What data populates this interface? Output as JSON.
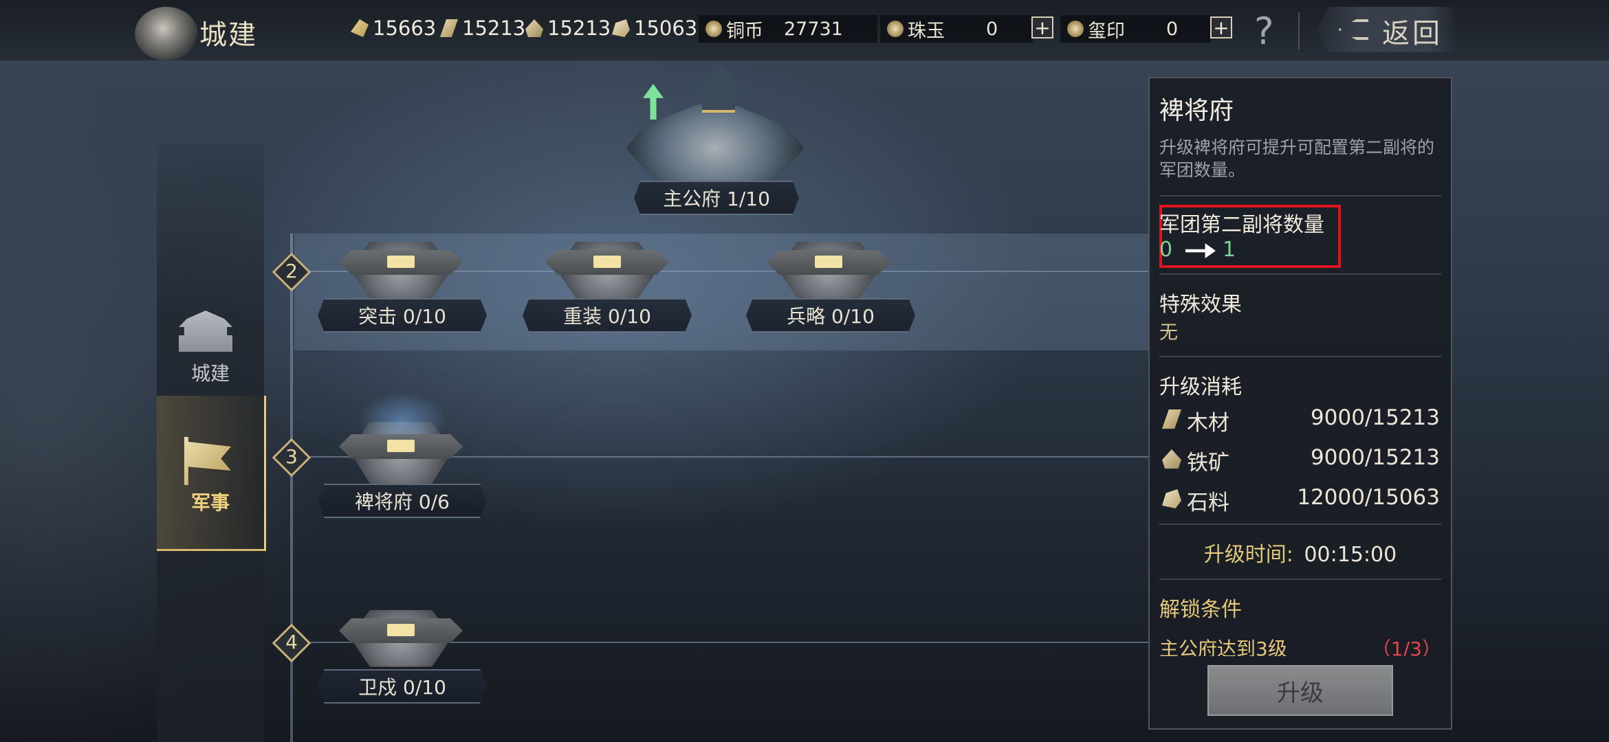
{
  "header": {
    "title": "城建",
    "resources": [
      {
        "icon": "grain-icon",
        "value": "15663"
      },
      {
        "icon": "wood-icon",
        "value": "15213"
      },
      {
        "icon": "iron-icon",
        "value": "15213"
      },
      {
        "icon": "stone-icon",
        "value": "15063"
      }
    ],
    "copper": {
      "label": "铜币",
      "value": "27731"
    },
    "jade": {
      "label": "珠玉",
      "value": "0"
    },
    "seal": {
      "label": "玺印",
      "value": "0"
    },
    "plus": "+",
    "help": "?",
    "back_label": "返回"
  },
  "nav": {
    "items": [
      {
        "label": "城建",
        "icon": "city-gate-icon",
        "active": false
      },
      {
        "label": "军事",
        "icon": "war-flag-icon",
        "active": true
      }
    ]
  },
  "tree": {
    "main": {
      "label": "主公府 1/10"
    },
    "tiers": [
      "2",
      "3",
      "4"
    ],
    "buildings": [
      {
        "label": "突击 0/10"
      },
      {
        "label": "重装 0/10"
      },
      {
        "label": "兵略 0/10"
      },
      {
        "label": "裨将府 0/6"
      },
      {
        "label": "卫戍 0/10"
      }
    ]
  },
  "panel": {
    "title": "裨将府",
    "description": "升级裨将府可提升可配置第二副将的军团数量。",
    "stat": {
      "label": "军团第二副将数量",
      "from": "0",
      "to": "1"
    },
    "special": {
      "label": "特殊效果",
      "value": "无"
    },
    "cost": {
      "label": "升级消耗",
      "items": [
        {
          "icon": "wood-icon",
          "name": "木材",
          "amount": "9000/15213"
        },
        {
          "icon": "iron-icon",
          "name": "铁矿",
          "amount": "9000/15213"
        },
        {
          "icon": "stone-icon",
          "name": "石料",
          "amount": "12000/15063"
        }
      ]
    },
    "time": {
      "label": "升级时间:",
      "value": "00:15:00"
    },
    "unlock": {
      "label": "解锁条件",
      "condition": "主公府达到3级",
      "progress": "（1/3）"
    },
    "upgrade_button": "升级"
  },
  "colors": {
    "accent_gold": "#e8cc82",
    "green": "#7ed197",
    "red_highlight": "#e0141e",
    "progress_red": "#e2474c"
  }
}
